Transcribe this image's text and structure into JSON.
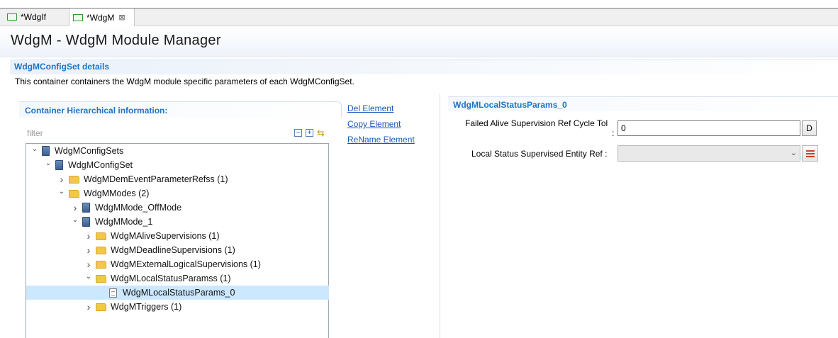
{
  "tabs": [
    {
      "label": "*WdgIf",
      "active": false
    },
    {
      "label": "*WdgM",
      "active": true,
      "close": "⊠"
    }
  ],
  "header": {
    "title": "WdgM - WdgM Module Manager"
  },
  "section": {
    "title": "WdgMConfigSet details",
    "description": "This container containers the WdgM module specific parameters of each WdgMConfigSet."
  },
  "container": {
    "title": "Container Hierarchical information:",
    "filter_placeholder": "filter",
    "toolbar": {
      "collapse_all_icon": "collapse-all-icon",
      "expand_all_icon": "expand-all-icon",
      "sync_icon": "sync-icon"
    }
  },
  "tree": [
    {
      "label": "WdgMConfigSets",
      "chevron": "v",
      "icon": "file",
      "level": 0,
      "selected": false
    },
    {
      "label": "WdgMConfigSet",
      "chevron": "v",
      "icon": "file",
      "level": 1,
      "selected": false
    },
    {
      "label": "WdgMDemEventParameterRefss (1)",
      "chevron": ">",
      "icon": "folder",
      "level": 2,
      "selected": false
    },
    {
      "label": "WdgMModes (2)",
      "chevron": "v",
      "icon": "folder",
      "level": 2,
      "selected": false
    },
    {
      "label": "WdgMMode_OffMode",
      "chevron": ">",
      "icon": "file",
      "level": 3,
      "selected": false
    },
    {
      "label": "WdgMMode_1",
      "chevron": "v",
      "icon": "file",
      "level": 3,
      "selected": false
    },
    {
      "label": "WdgMAliveSupervisions (1)",
      "chevron": ">",
      "icon": "folder",
      "level": 4,
      "selected": false
    },
    {
      "label": "WdgMDeadlineSupervisions (1)",
      "chevron": ">",
      "icon": "folder",
      "level": 4,
      "selected": false
    },
    {
      "label": "WdgMExternalLogicalSupervisions (1)",
      "chevron": ">",
      "icon": "folder",
      "level": 4,
      "selected": false
    },
    {
      "label": "WdgMLocalStatusParamss (1)",
      "chevron": "v",
      "icon": "folder",
      "level": 4,
      "selected": false
    },
    {
      "label": "WdgMLocalStatusParams_0",
      "chevron": "",
      "icon": "doc",
      "level": 5,
      "selected": true
    },
    {
      "label": "WdgMTriggers (1)",
      "chevron": ">",
      "icon": "folder",
      "level": 4,
      "selected": false
    }
  ],
  "actions": {
    "del": "Del Element",
    "copy": "Copy Element",
    "rename": "ReName Element"
  },
  "details": {
    "title": "WdgMLocalStatusParams_0",
    "failed_label": "Failed Alive Supervision Ref Cycle Tol",
    "failed_colon": ":",
    "failed_value": "0",
    "default_button": "D",
    "local_status_label": "Local Status Supervised Entity Ref :",
    "local_status_value": ""
  }
}
